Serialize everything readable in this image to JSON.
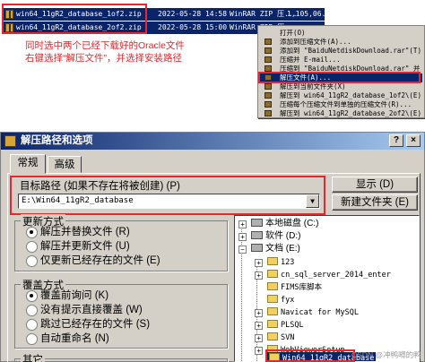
{
  "files": [
    {
      "name": "win64_11gR2_database_1of2.zip",
      "date": "2022-05-28 14:58",
      "type": "WinRAR ZIP 压...",
      "size": "1,105,06..."
    },
    {
      "name": "win64_11gR2_database_2of2.zip",
      "date": "2022-05-28 15:00",
      "type": "WinRAR ZIP 压...",
      "size": "..."
    }
  ],
  "annotation": {
    "line1": "同时选中两个已经下载好的Oracle文件",
    "line2": "右键选择“解压文件”，并选择安装路径"
  },
  "context_menu": [
    "打开(O)",
    "添加到压缩文件(A)...",
    "添加到 \"BaiduNetdiskDownload.rar\"(T)",
    "压缩并 E-mail...",
    "压缩到 \"BaiduNetdiskDownload.rar\" 并 E-mail",
    "解压文件(A)...",
    "解压到当前文件夹(X)",
    "解压到 win64_11gR2_database_1of2\\(E)",
    "压缩每个压缩文件到单独的压缩文件(R)...",
    "解压到 win64_11gR2_database_2of2\\(E)"
  ],
  "context_menu_selected": 5,
  "dialog": {
    "title": "解压路径和选项",
    "help_btn": "?",
    "close_btn": "×",
    "tabs": [
      "常规",
      "高级"
    ],
    "target_label": "目标路径 (如果不存在将被创建) (P)",
    "target_value": "E:\\Win64_11gR2_database",
    "show_btn": "显示 (D)",
    "newfolder_btn": "新建文件夹 (E)",
    "update_title": "更新方式",
    "update_options": [
      "解压并替换文件 (R)",
      "解压并更新文件 (U)",
      "仅更新已经存在的文件 (E)"
    ],
    "overwrite_title": "覆盖方式",
    "overwrite_options": [
      "覆盖前询问 (K)",
      "没有提示直接覆盖 (W)",
      "跳过已经存在的文件 (S)",
      "自动重命名 (N)"
    ],
    "other_title": "其它"
  },
  "tree": {
    "drive_local": "本地磁盘 (C:)",
    "software": "软件 (D:)",
    "docs": "文档 (E:)",
    "folders": [
      "123",
      "cn_sql_server_2014_enter",
      "FIMS库脚本",
      "fyx",
      "Navicat for MySQL",
      "PLSQL",
      "SVN",
      "WebViewerSetup",
      "Win64_11gR2_database"
    ]
  },
  "watermark": "CSDN @冲鸭嘚的鸭"
}
